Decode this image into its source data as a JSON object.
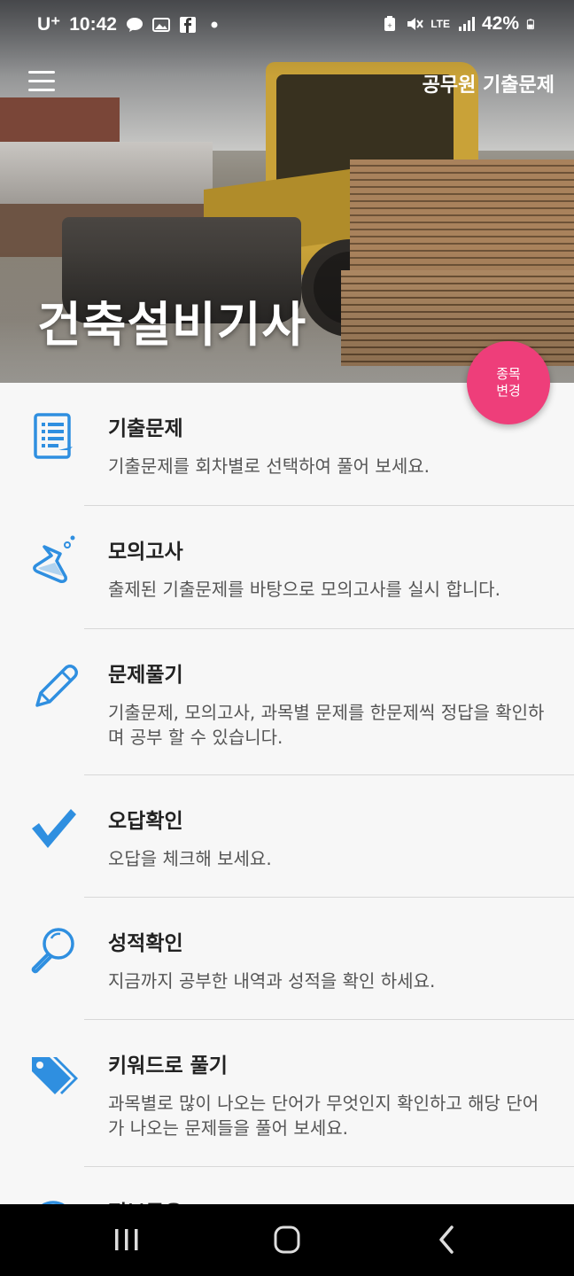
{
  "status_bar": {
    "carrier": "U⁺",
    "time": "10:42",
    "network": "LTE",
    "battery": "42%"
  },
  "app_bar": {
    "title": "공무원 기출문제"
  },
  "hero": {
    "title": "건축설비기사"
  },
  "fab": {
    "line1": "종목",
    "line2": "변경",
    "color": "#ee3e7a"
  },
  "accent_color": "#2f8fe0",
  "menu": [
    {
      "icon": "document-list-icon",
      "title": "기출문제",
      "desc": "기출문제를 회차별로 선택하여 풀어 보세요."
    },
    {
      "icon": "flask-icon",
      "title": "모의고사",
      "desc": "출제된 기출문제를 바탕으로 모의고사를 실시 합니다."
    },
    {
      "icon": "pencil-icon",
      "title": "문제풀기",
      "desc": "기출문제, 모의고사, 과목별 문제를 한문제씩 정답을 확인하며 공부 할 수 있습니다."
    },
    {
      "icon": "checkmark-icon",
      "title": "오답확인",
      "desc": "오답을 체크해 보세요."
    },
    {
      "icon": "magnifier-icon",
      "title": "성적확인",
      "desc": "지금까지 공부한 내역과 성적을 확인 하세요."
    },
    {
      "icon": "tag-icon",
      "title": "키워드로 풀기",
      "desc": "과목별로 많이 나오는 단어가 무엇인지 확인하고 해당 단어가 나오는 문제들을 풀어 보세요."
    },
    {
      "icon": "info-share-icon",
      "title": "정보공유",
      "desc": ""
    }
  ]
}
